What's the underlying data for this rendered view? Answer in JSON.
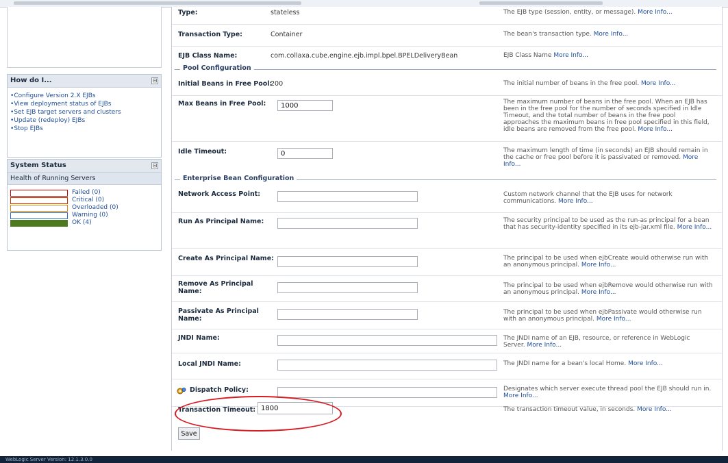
{
  "footer": {
    "version_text": "WebLogic Server Version: 12.1.3.0.0"
  },
  "sidebar": {
    "howdo": {
      "title": "How do I...",
      "toggle": "⊟",
      "items": [
        "Configure Version 2.X EJBs",
        "View deployment status of EJBs",
        "Set EJB target servers and clusters",
        "Update (redeploy) EJBs",
        "Stop EJBs"
      ]
    },
    "system_status": {
      "title": "System Status",
      "toggle": "⊟",
      "health_title": "Health of Running Servers",
      "items": [
        {
          "label": "Failed (0)",
          "fill_fraction": 0,
          "color": "#cc0000"
        },
        {
          "label": "Critical (0)",
          "fill_fraction": 0,
          "color": "#cc3300"
        },
        {
          "label": "Overloaded (0)",
          "fill_fraction": 0,
          "color": "#e08a00"
        },
        {
          "label": "Warning (0)",
          "fill_fraction": 0,
          "color": "#3366cc"
        },
        {
          "label": "OK (4)",
          "fill_fraction": 1,
          "color": "#4d7a1e"
        }
      ]
    }
  },
  "more_info": "More Info...",
  "form": {
    "type": {
      "label": "Type:",
      "value": "stateless",
      "desc": "The EJB type (session, entity, or message)."
    },
    "transaction_type": {
      "label": "Transaction Type:",
      "value": "Container",
      "desc": "The bean's transaction type."
    },
    "ejb_class_name": {
      "label": "EJB Class Name:",
      "value": "com.collaxa.cube.engine.ejb.impl.bpel.BPELDeliveryBean",
      "desc": "EJB Class Name"
    },
    "pool_section": "Pool Configuration",
    "initial_beans": {
      "label": "Initial Beans in Free Pool:",
      "value": "200",
      "desc": "The initial number of beans in the free pool."
    },
    "max_beans": {
      "label": "Max Beans in Free Pool:",
      "value": "1000",
      "desc": "The maximum number of beans in the free pool. When an EJB has been in the free pool for the number of seconds specified in Idle Timeout, and the total number of beans in the free pool approaches the maximum beans in free pool specified in this field, idle beans are removed from the free pool."
    },
    "idle_timeout": {
      "label": "Idle Timeout:",
      "value": "0",
      "desc": "The maximum length of time (in seconds) an EJB should remain in the cache or free pool before it is passivated or removed."
    },
    "ebc_section": "Enterprise Bean Configuration",
    "network_access_point": {
      "label": "Network Access Point:",
      "value": "",
      "desc": "Custom network channel that the EJB uses for network communications."
    },
    "run_as_principal": {
      "label": "Run As Principal Name:",
      "value": "",
      "desc": "The security principal to be used as the run-as principal for a bean that has security-identity specified in its ejb-jar.xml file."
    },
    "create_as_principal": {
      "label": "Create As Principal Name:",
      "value": "",
      "desc": "The principal to be used when ejbCreate would otherwise run with an anonymous principal."
    },
    "remove_as_principal": {
      "label": "Remove As Principal Name:",
      "value": "",
      "desc": "The principal to be used when ejbRemove would otherwise run with an anonymous principal."
    },
    "passivate_as_principal": {
      "label": "Passivate As Principal Name:",
      "value": "",
      "desc": "The principal to be used when ejbPassivate would otherwise run with an anonymous principal."
    },
    "jndi_name": {
      "label": "JNDI Name:",
      "value": "",
      "desc": "The JNDI name of an EJB, resource, or reference in WebLogic Server."
    },
    "local_jndi_name": {
      "label": "Local JNDI Name:",
      "value": "",
      "desc": "The JNDI name for a bean's local Home."
    },
    "dispatch_policy": {
      "label": "Dispatch Policy:",
      "value": "",
      "desc": "Designates which server execute thread pool the EJB should run in."
    },
    "transaction_timeout": {
      "label": "Transaction Timeout:",
      "value": "1800",
      "desc": "The transaction timeout value, in seconds."
    },
    "save_label": "Save"
  }
}
